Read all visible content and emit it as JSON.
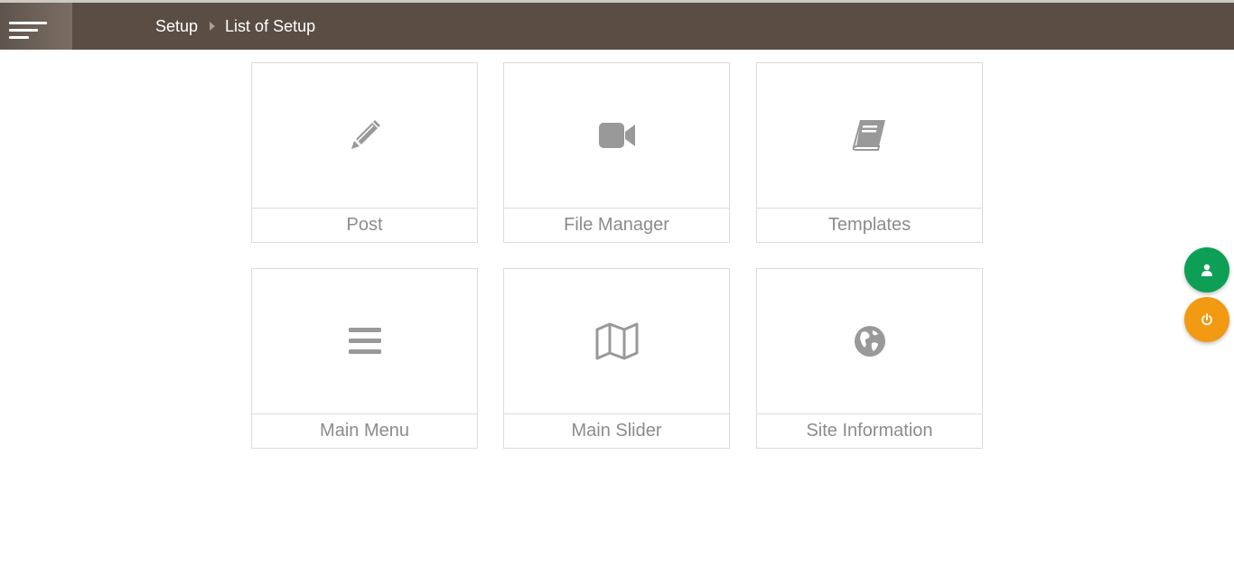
{
  "header": {
    "breadcrumb": {
      "root": "Setup",
      "current": "List of Setup"
    }
  },
  "tiles": [
    {
      "label": "Post",
      "icon": "pencil-icon"
    },
    {
      "label": "File Manager",
      "icon": "video-camera-icon"
    },
    {
      "label": "Templates",
      "icon": "book-icon"
    },
    {
      "label": "Main Menu",
      "icon": "menu-bars-icon"
    },
    {
      "label": "Main Slider",
      "icon": "map-icon"
    },
    {
      "label": "Site Information",
      "icon": "globe-icon"
    }
  ],
  "fabs": {
    "user": {
      "icon": "user-icon",
      "color": "#0e9f57"
    },
    "power": {
      "icon": "power-icon",
      "color": "#f19a12"
    }
  },
  "colors": {
    "header_bg": "#5a4d43",
    "tile_icon": "#999999",
    "tile_text": "#8c8c8c"
  }
}
